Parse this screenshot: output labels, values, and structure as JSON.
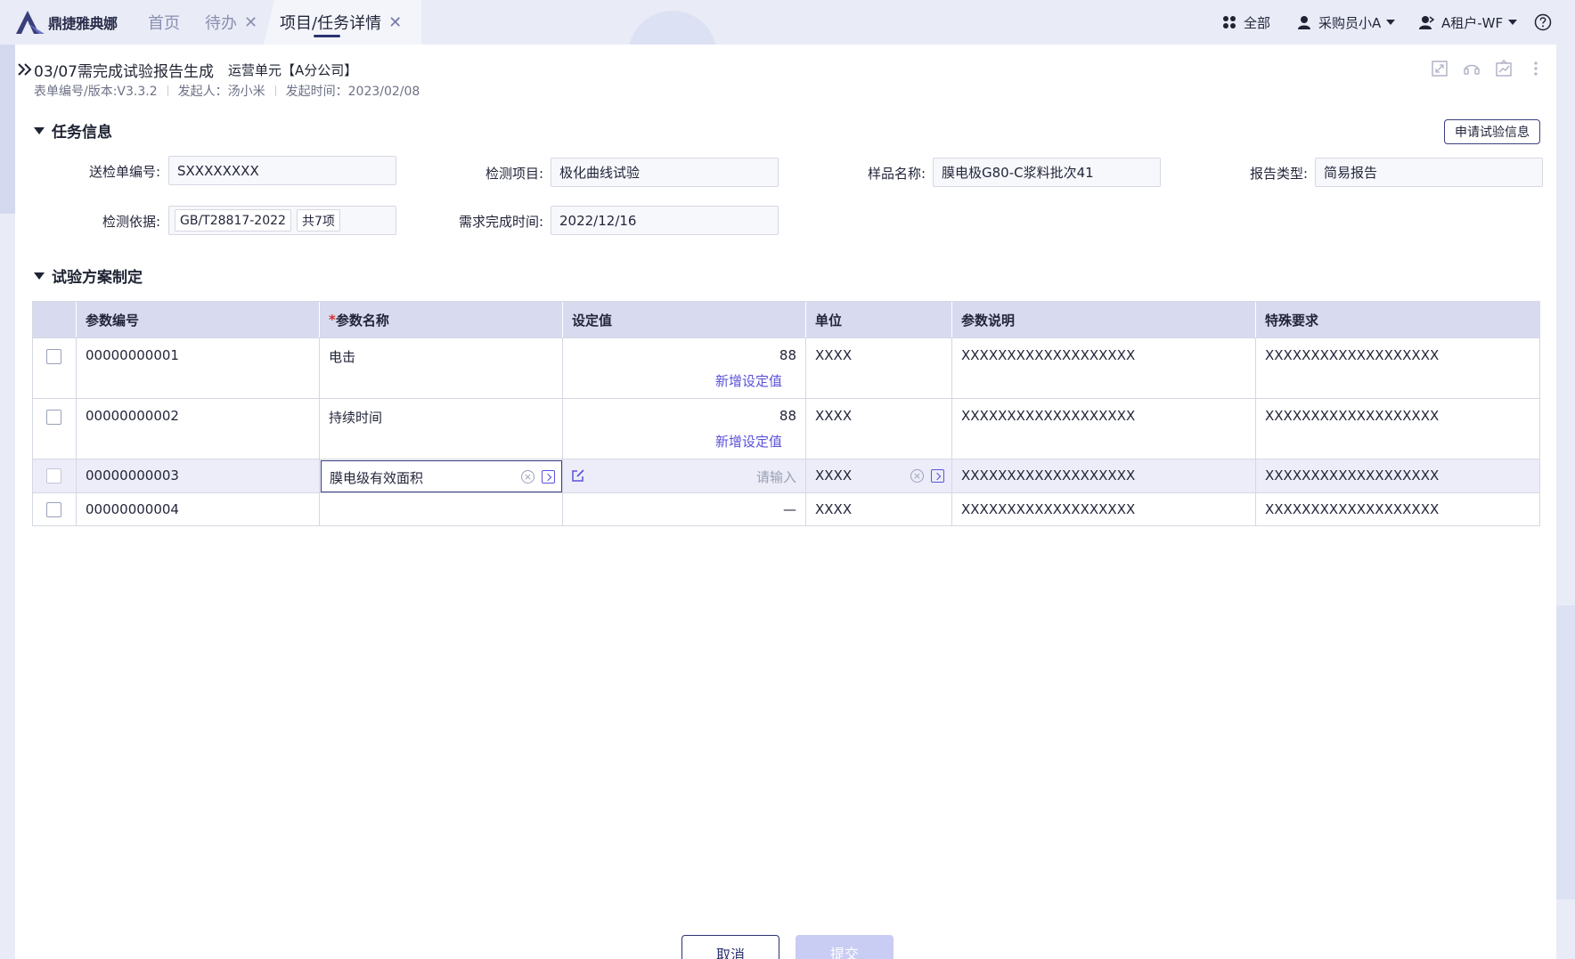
{
  "app": {
    "logo_text": "鼎捷雅典娜"
  },
  "tabs": [
    {
      "label": "首页",
      "closable": false,
      "active": false
    },
    {
      "label": "待办",
      "closable": true,
      "active": false
    },
    {
      "label": "项目/任务详情",
      "closable": true,
      "active": true
    }
  ],
  "top_right": {
    "all_label": "全部",
    "user_label": "采购员小A",
    "tenant_label": "A租户-WF"
  },
  "task": {
    "title": "03/07需完成试验报告生成",
    "org": "运营单元【A分公司】",
    "form_version": "表单编号/版本:V3.3.2",
    "initiator": "发起人：汤小米",
    "initiated_time": "发起时间：2023/02/08"
  },
  "task_info": {
    "section_title": "任务信息",
    "apply_button": "申请试验信息",
    "fields": {
      "inspection_no_label": "送检单编号:",
      "inspection_no_value": "SXXXXXXXX",
      "test_item_label": "检测项目:",
      "test_item_value": "极化曲线试验",
      "sample_name_label": "样品名称:",
      "sample_name_value": "膜电极G80-C浆料批次41",
      "report_type_label": "报告类型:",
      "report_type_value": "简易报告",
      "basis_label": "检测依据:",
      "basis_tag": "GB/T28817-2022",
      "basis_count": "共7项",
      "due_label": "需求完成时间:",
      "due_value": "2022/12/16"
    }
  },
  "plan": {
    "section_title": "试验方案制定",
    "columns": {
      "param_no": "参数编号",
      "required_mark": "*",
      "param_name": "参数名称",
      "set_value": "设定值",
      "unit": "单位",
      "param_desc": "参数说明",
      "special": "特殊要求"
    },
    "add_value_label": "新增设定值",
    "input_placeholder": "请输入",
    "rows": [
      {
        "no": "00000000001",
        "name": "电击",
        "value": "88",
        "unit": "XXXX",
        "desc": "XXXXXXXXXXXXXXXXXXX",
        "special": "XXXXXXXXXXXXXXXXXXX"
      },
      {
        "no": "00000000002",
        "name": "持续时间",
        "value": "88",
        "unit": "XXXX",
        "desc": "XXXXXXXXXXXXXXXXXXX",
        "special": "XXXXXXXXXXXXXXXXXXX"
      },
      {
        "no": "00000000003",
        "name": "膜电级有效面积",
        "value": "",
        "unit": "XXXX",
        "desc": "XXXXXXXXXXXXXXXXXXX",
        "special": "XXXXXXXXXXXXXXXXXXX"
      },
      {
        "no": "00000000004",
        "name": "",
        "value": "—",
        "unit": "XXXX",
        "desc": "XXXXXXXXXXXXXXXXXXX",
        "special": "XXXXXXXXXXXXXXXXXXX"
      }
    ]
  },
  "footer": {
    "cancel": "取消",
    "submit": "提交"
  },
  "colors": {
    "accent": "#2c3370",
    "link": "#5b52d9",
    "table_header": "#d8dbef",
    "submit_disabled": "#c9cdf3"
  }
}
